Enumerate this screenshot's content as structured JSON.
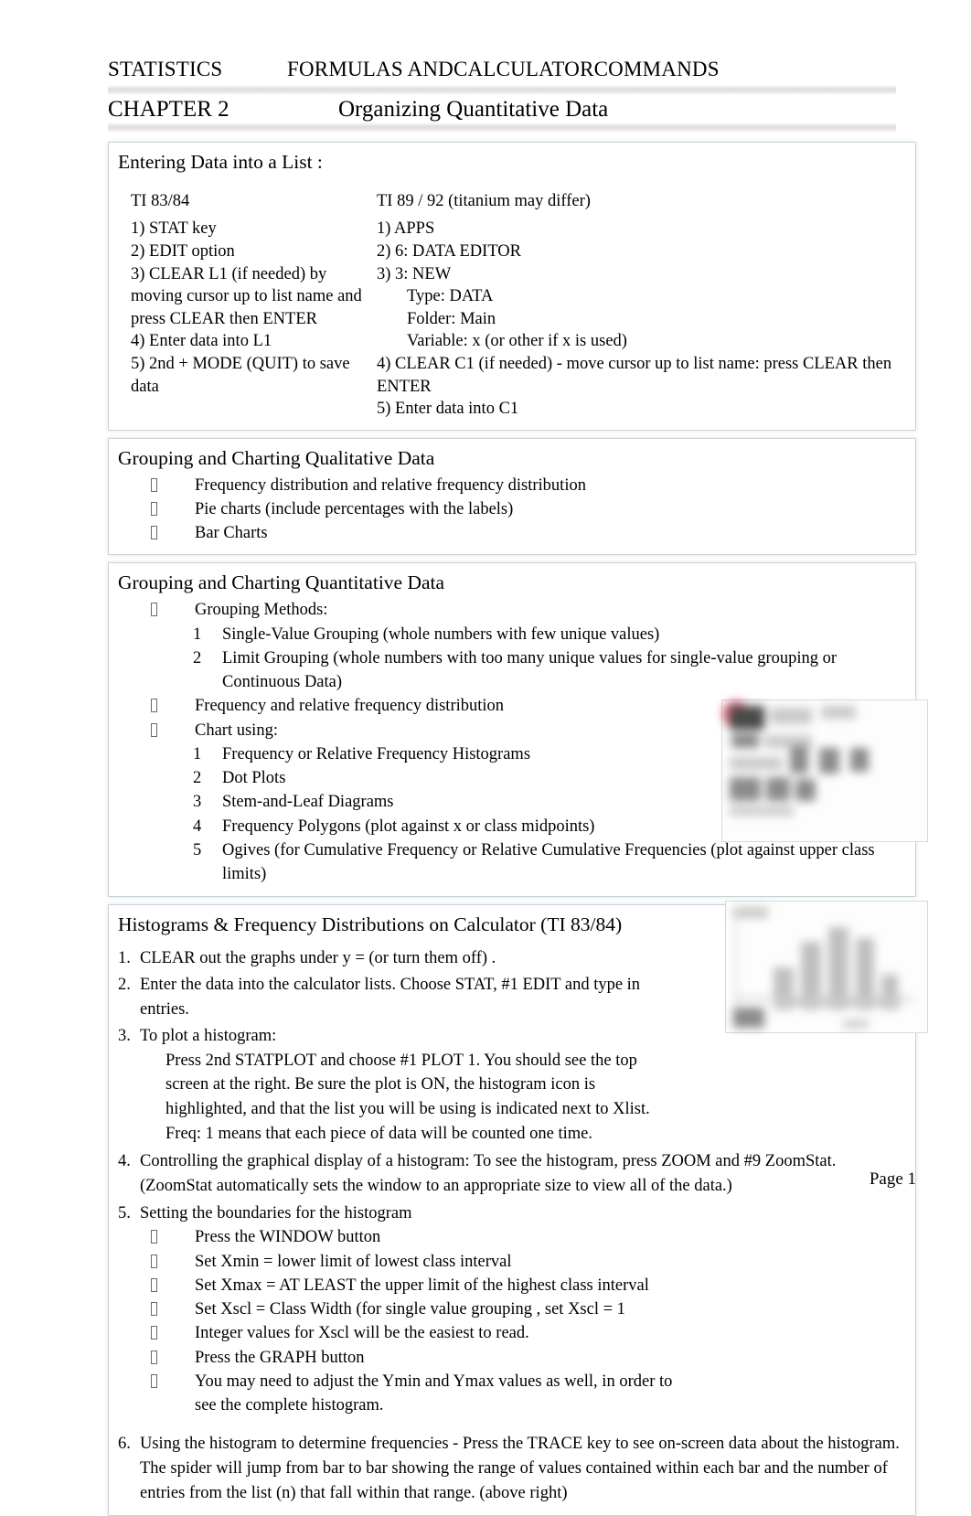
{
  "running_head": {
    "left": "STATISTICS",
    "right": "FORMULAS AND",
    "right2": "CALCULATOR",
    "right3": "COMMANDS"
  },
  "chapter": {
    "label": "CHAPTER 2",
    "title": "Organizing Quantitative Data"
  },
  "sections": {
    "entering_data": {
      "title": "Entering Data into a List   :",
      "table": {
        "col1_header": "TI 83/84",
        "col2_header": "TI 89 / 92 (titanium may differ)",
        "col1_lines": [
          "1) STAT key",
          "2) EDIT option",
          "3) CLEAR L1 (if needed) by",
          "moving cursor up to list name and",
          "press CLEAR then ENTER",
          "4) Enter data into L1",
          "5) 2nd + MODE (QUIT) to save",
          "data"
        ],
        "col2_lines": [
          "1) APPS",
          "2) 6: DATA EDITOR",
          "3) 3: NEW"
        ],
        "col2_indented": [
          "Type: DATA",
          "Folder: Main",
          "Variable: x (or other if x is used)"
        ],
        "col2_lines_after": [
          "4) CLEAR C1 (if needed) - move cursor up to list name: press CLEAR then ENTER",
          "5) Enter data into C1"
        ]
      }
    },
    "qualitative": {
      "title": "Grouping and Charting Qualitative Data",
      "bullets": [
        "Frequency distribution and relative frequency distribution",
        "Pie charts (include percentages with the labels)",
        "Bar Charts"
      ]
    },
    "quantitative": {
      "title": "Grouping and Charting Quantitative Data",
      "bullet1": "Grouping Methods:",
      "methods": [
        {
          "num": "1",
          "text": "Single-Value Grouping (whole numbers with few unique values)"
        },
        {
          "num": "2",
          "text": "Limit Grouping (whole numbers with too many unique values for single-value grouping or Continuous Data)"
        }
      ],
      "bullet2": "Frequency and relative frequency distribution",
      "bullet3": "Chart using:",
      "charts": [
        {
          "num": "1",
          "text": "Frequency or Relative Frequency Histograms"
        },
        {
          "num": "2",
          "text": "Dot Plots"
        },
        {
          "num": "3",
          "text": "Stem-and-Leaf Diagrams"
        },
        {
          "num": "4",
          "text": "Frequency Polygons (plot against x or class midpoints)"
        },
        {
          "num": "5",
          "text": "Ogives (for Cumulative Frequency or Relative Cumulative Frequencies (plot against upper class limits)"
        }
      ]
    },
    "histograms": {
      "title": "Histograms & Frequency Distributions on Calculator (TI 83/84)",
      "step1_num": "1.",
      "step1_text": "CLEAR out the graphs under y = (or turn them off)  .",
      "step2_num": "2.",
      "step2_text": "Enter the data into the calculator lists. Choose STAT, #1 EDIT   and type in entries.",
      "step3_num": "3.",
      "step3_text": "To plot a histogram:",
      "step3_body": "Press 2nd STATPLOT   and choose #1 PLOT 1.  You should see the top screen at the right. Be sure the plot is ON, the histogram icon is highlighted, and that the list you will be using is indicated next to Xlist. Freq: 1  means that each piece of data will be counted one time.",
      "step4_num": "4.",
      "step4_text": "Controlling the graphical display of a histogram:        To see the histogram, press ZOOM  and #9 ZoomStat.   (ZoomStat automatically sets the window to an appropriate size to view all of the data.)",
      "step5_num": "5.",
      "step5_text": "Setting the boundaries for the histogram",
      "step5_bullets": [
        "Press the WINDOW  button",
        "Set Xmin  = lower limit of lowest class interval",
        "Set Xmax = AT LEAST the upper limit of the highest class interval",
        "Set Xscl = Class Width (for single value grouping  , set Xscl = 1",
        "Integer values   for Xscl will be the easiest to read.",
        "Press the GRAPH  button",
        "You may need to adjust the  Ymin and Ymax values as well, in order to see the complete histogram."
      ],
      "step6_num": "6.",
      "step6_text": "Using the histogram to determine frequencies -      Press the TRACE  key to see on-screen data about the histogram. The spider will jump from bar to bar showing the range of values contained within each bar and the number of entries from the list (n) that fall within that range. (above right)"
    }
  },
  "footer": {
    "page_label": "Page 1"
  },
  "images": {
    "statplot_screen_alt": "calculator-statplot-screen",
    "histogram_screen_alt": "calculator-histogram-screen"
  },
  "colors": {
    "section_border": "#becbd1",
    "separator": "#cecece",
    "text": "#000000",
    "highlight_red": "#e2697c"
  }
}
